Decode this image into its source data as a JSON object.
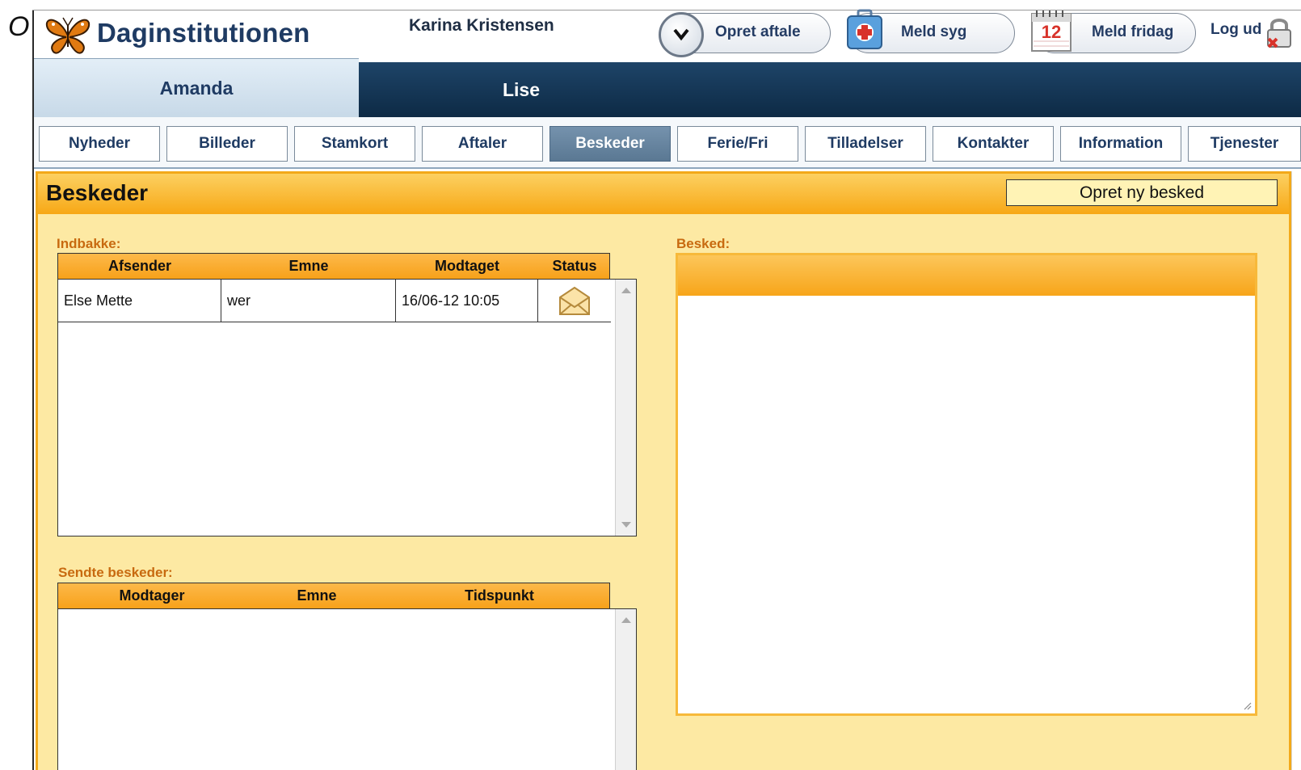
{
  "stray_text": "O",
  "app": {
    "brand": "Daginstitutionen",
    "user": "Karina Kristensen"
  },
  "header_actions": {
    "appointment": "Opret aftale",
    "sick": "Meld syg",
    "dayoff": "Meld fridag",
    "dayoff_calendar_day": "12",
    "logout": "Log ud"
  },
  "children": {
    "active": "Amanda",
    "other": "Lise"
  },
  "nav": {
    "items": [
      "Nyheder",
      "Billeder",
      "Stamkort",
      "Aftaler",
      "Beskeder",
      "Ferie/Fri",
      "Tilladelser",
      "Kontakter",
      "Information",
      "Tjenester"
    ],
    "active": "Beskeder"
  },
  "page": {
    "title": "Beskeder",
    "new_message_button": "Opret ny besked"
  },
  "inbox": {
    "label": "Indbakke:",
    "columns": [
      "Afsender",
      "Emne",
      "Modtaget",
      "Status"
    ],
    "rows": [
      {
        "sender": "Else Mette",
        "subject": "wer",
        "received": "16/06-12 10:05",
        "status_icon": "envelope-icon"
      }
    ]
  },
  "sent": {
    "label": "Sendte beskeder:",
    "columns": [
      "Modtager",
      "Emne",
      "Tidspunkt"
    ],
    "rows": []
  },
  "message": {
    "label": "Besked:",
    "body": ""
  },
  "colors": {
    "accent_orange": "#f7a816",
    "panel_bg": "#fde9a3",
    "nav_dark": "#0d2a45",
    "label_orange": "#c86a10"
  }
}
